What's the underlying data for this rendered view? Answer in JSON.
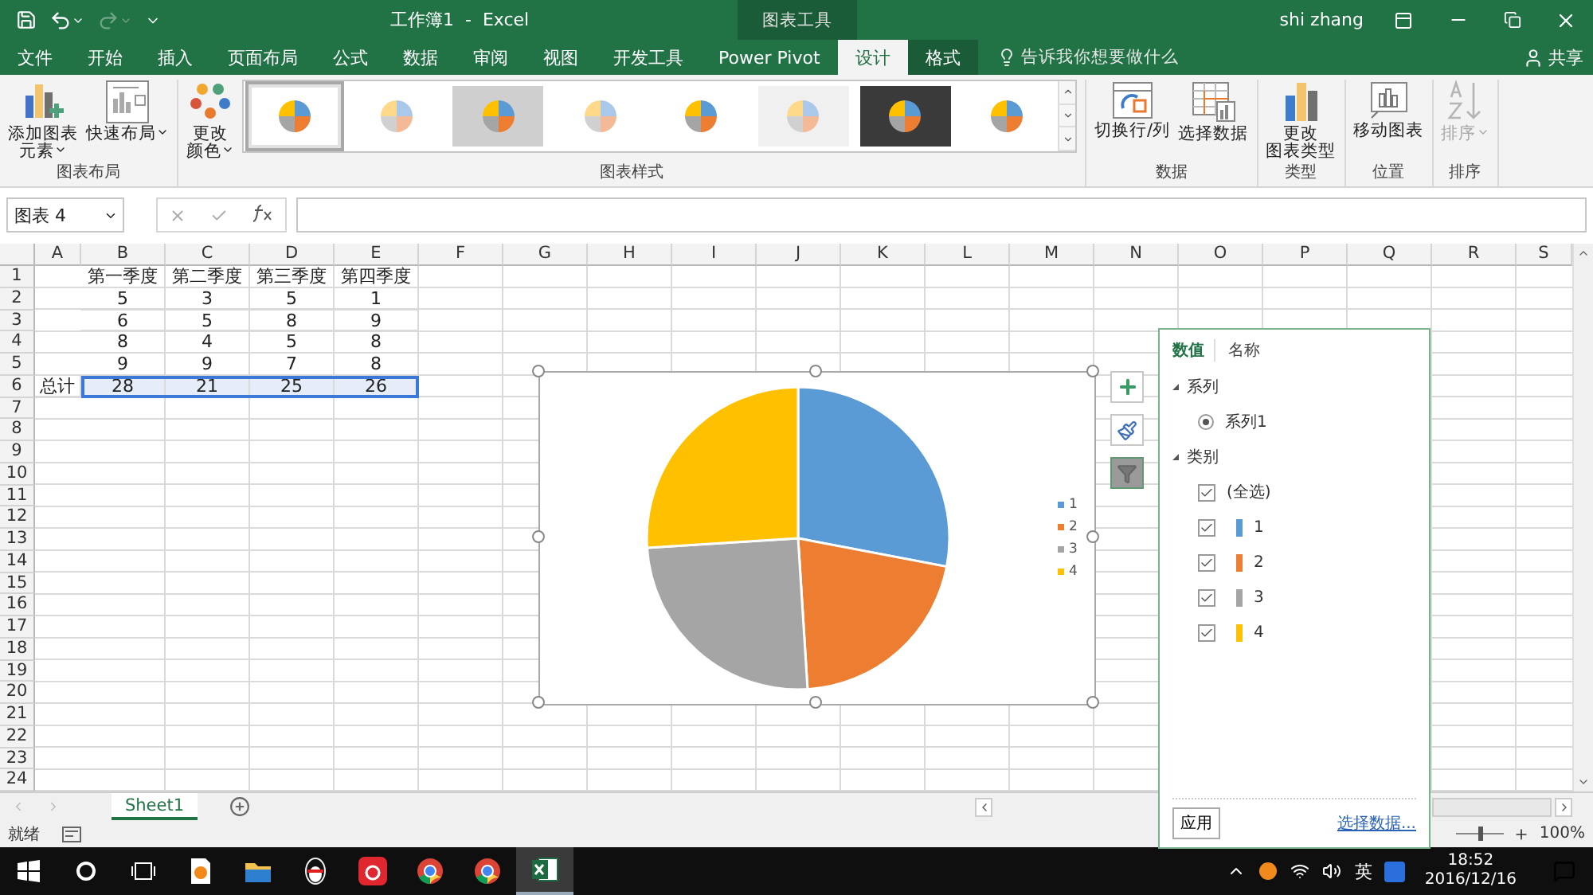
{
  "title_bar": {
    "title": "工作簿1  -  Excel",
    "context_label": "图表工具",
    "user": "shi zhang"
  },
  "ribbon_tabs": [
    {
      "label": "文件",
      "selected": false,
      "kind": "normal"
    },
    {
      "label": "开始",
      "selected": false,
      "kind": "normal"
    },
    {
      "label": "插入",
      "selected": false,
      "kind": "normal"
    },
    {
      "label": "页面布局",
      "selected": false,
      "kind": "normal"
    },
    {
      "label": "公式",
      "selected": false,
      "kind": "normal"
    },
    {
      "label": "数据",
      "selected": false,
      "kind": "normal"
    },
    {
      "label": "审阅",
      "selected": false,
      "kind": "normal"
    },
    {
      "label": "视图",
      "selected": false,
      "kind": "normal"
    },
    {
      "label": "开发工具",
      "selected": false,
      "kind": "normal"
    },
    {
      "label": "Power Pivot",
      "selected": false,
      "kind": "normal"
    },
    {
      "label": "设计",
      "selected": true,
      "kind": "contextual"
    },
    {
      "label": "格式",
      "selected": false,
      "kind": "contextual"
    }
  ],
  "tell_me": "告诉我你想要做什么",
  "share": "共享",
  "ribbon_groups": [
    {
      "label": "图表布局",
      "buttons": [
        {
          "lines": [
            "添加图表",
            "元素"
          ],
          "kind": "add-element",
          "dropdown": true,
          "disabled": false
        },
        {
          "lines": [
            "快速布局"
          ],
          "kind": "quick-layout",
          "dropdown": true,
          "disabled": false
        }
      ]
    },
    {
      "label": "图表样式",
      "buttons": [
        {
          "lines": [
            "更改",
            "颜色"
          ],
          "kind": "change-colors",
          "dropdown": true,
          "disabled": false
        }
      ],
      "gallery": [
        {
          "kind": "plain",
          "selected": true
        },
        {
          "kind": "hatched",
          "selected": false
        },
        {
          "kind": "gradient",
          "selected": false
        },
        {
          "kind": "pastel",
          "selected": false
        },
        {
          "kind": "plain",
          "selected": false
        },
        {
          "kind": "hatched-ground",
          "selected": false
        },
        {
          "kind": "dark",
          "selected": false
        },
        {
          "kind": "labeled",
          "selected": false
        }
      ]
    },
    {
      "label": "数据",
      "buttons": [
        {
          "lines": [
            "切换行/列"
          ],
          "kind": "switch-row-column",
          "dropdown": false,
          "disabled": false
        },
        {
          "lines": [
            "选择数据"
          ],
          "kind": "select-data",
          "dropdown": false,
          "disabled": false
        }
      ]
    },
    {
      "label": "类型",
      "buttons": [
        {
          "lines": [
            "更改",
            "图表类型"
          ],
          "kind": "change-type",
          "dropdown": false,
          "disabled": false
        }
      ]
    },
    {
      "label": "位置",
      "buttons": [
        {
          "lines": [
            "移动图表"
          ],
          "kind": "move-chart",
          "dropdown": false,
          "disabled": false
        }
      ]
    },
    {
      "label": "排序",
      "buttons": [
        {
          "lines": [
            "排序"
          ],
          "kind": "sort",
          "dropdown": true,
          "disabled": true
        }
      ]
    }
  ],
  "formula_bar": {
    "name_box": "图表 4"
  },
  "sheet": {
    "columns": [
      "A",
      "B",
      "C",
      "D",
      "E",
      "F",
      "G",
      "H",
      "I",
      "J",
      "K",
      "L",
      "M",
      "N",
      "O",
      "P",
      "Q",
      "R",
      "S"
    ],
    "row_numbers": [
      "1",
      "2",
      "3",
      "4",
      "5",
      "6",
      "7",
      "8",
      "9",
      "10",
      "11",
      "12",
      "13",
      "14",
      "15",
      "16",
      "17",
      "18",
      "19",
      "20",
      "21",
      "22",
      "23",
      "24"
    ],
    "rows": [
      {
        "values": [
          "第一季度",
          "第二季度",
          "第三季度",
          "第四季度"
        ],
        "selected": false
      },
      {
        "values": [
          "5",
          "3",
          "5",
          "1"
        ],
        "selected": false
      },
      {
        "values": [
          "6",
          "5",
          "8",
          "9"
        ],
        "selected": false
      },
      {
        "values": [
          "8",
          "4",
          "5",
          "8"
        ],
        "selected": false
      },
      {
        "values": [
          "9",
          "9",
          "7",
          "8"
        ],
        "selected": false
      },
      {
        "label": "总计",
        "values": [
          "28",
          "21",
          "25",
          "26"
        ],
        "selected": true
      }
    ]
  },
  "chart": {
    "chart_data": {
      "type": "pie",
      "categories": [
        "1",
        "2",
        "3",
        "4"
      ],
      "values": [
        28,
        21,
        25,
        26
      ],
      "legend": "right"
    },
    "legend": [
      {
        "color": "#5b9bd5"
      },
      {
        "color": "#ed7d31"
      },
      {
        "color": "#a5a5a5"
      },
      {
        "color": "#ffc000"
      }
    ]
  },
  "chart_tools": [
    {
      "kind": "add",
      "selected": false
    },
    {
      "kind": "style",
      "selected": false
    },
    {
      "kind": "filter",
      "selected": true
    }
  ],
  "filter_pane": {
    "tabs": [
      {
        "label": "数值",
        "selected": true
      },
      {
        "label": "名称",
        "selected": false
      }
    ],
    "sections": [
      {
        "label": "系列",
        "kind": "radio",
        "expanded": true,
        "items": [
          {
            "label": "系列1",
            "selected": true
          }
        ]
      },
      {
        "label": "类别",
        "kind": "checkbox",
        "expanded": true,
        "items": [
          {
            "label": "(全选)",
            "checked": true
          },
          {
            "label": "1",
            "checked": true,
            "color": "#5b9bd5"
          },
          {
            "label": "2",
            "checked": true,
            "color": "#ed7d31"
          },
          {
            "label": "3",
            "checked": true,
            "color": "#a5a5a5"
          },
          {
            "label": "4",
            "checked": true,
            "color": "#ffc000"
          }
        ]
      }
    ],
    "apply_button": "应用",
    "link": "选择数据..."
  },
  "sheet_tabs": [
    {
      "label": "Sheet1",
      "selected": true
    }
  ],
  "status_bar": {
    "status": "就绪",
    "zoom": "100%",
    "zoom_slider": {
      "level": 0.5
    }
  },
  "taskbar": {
    "apps": [
      {
        "kind": "document",
        "active": false
      },
      {
        "kind": "folder",
        "active": false
      },
      {
        "kind": "penguin",
        "active": false
      },
      {
        "kind": "music",
        "active": false
      },
      {
        "kind": "browser",
        "active": false
      },
      {
        "kind": "browser",
        "active": false
      },
      {
        "kind": "excel",
        "active": true
      }
    ],
    "ime": "英",
    "time": "18:52",
    "date": "2016/12/16"
  }
}
